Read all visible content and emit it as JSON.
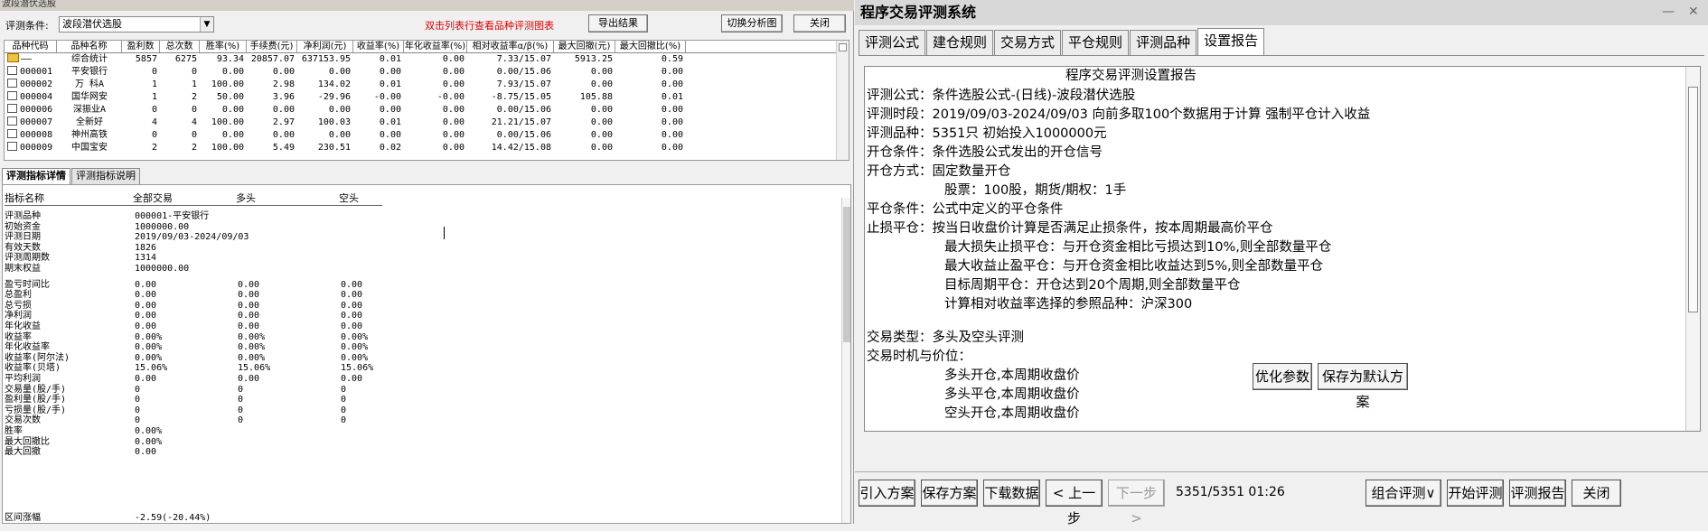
{
  "left_window": {
    "title": "波段潜伏选股",
    "condition_label": "评测条件:",
    "condition_value": "波段潜伏选股",
    "hint": "双击列表行查看品种评测图表",
    "export_label": "导出结果",
    "switch_label": "切换分析图",
    "close_label": "关闭",
    "columns": [
      "品种代码",
      "品种名称",
      "盈利数",
      "总次数",
      "胜率(%)",
      "手续费(元)",
      "净利润(元)",
      "收益率(%)",
      "年化收益率(%)",
      "相对收益率α/β(%)",
      "最大回撤(元)",
      "最大回撤比(%)"
    ],
    "rows": [
      [
        "——",
        "综合统计",
        "5857",
        "6275",
        "93.34",
        "20857.07",
        "637153.95",
        "0.01",
        "0.00",
        "7.33/15.07",
        "5913.25",
        "0.59"
      ],
      [
        "000001",
        "平安银行",
        "0",
        "0",
        "0.00",
        "0.00",
        "0.00",
        "0.00",
        "0.00",
        "0.00/15.06",
        "0.00",
        "0.00"
      ],
      [
        "000002",
        "万 科A",
        "1",
        "1",
        "100.00",
        "2.98",
        "134.02",
        "0.01",
        "0.00",
        "7.93/15.07",
        "0.00",
        "0.00"
      ],
      [
        "000004",
        "国华网安",
        "1",
        "2",
        "50.00",
        "3.96",
        "-29.96",
        "-0.00",
        "-0.00",
        "-8.75/15.05",
        "105.88",
        "0.01"
      ],
      [
        "000006",
        "深振业A",
        "0",
        "0",
        "0.00",
        "0.00",
        "0.00",
        "0.00",
        "0.00",
        "0.00/15.06",
        "0.00",
        "0.00"
      ],
      [
        "000007",
        "全新好",
        "4",
        "4",
        "100.00",
        "2.97",
        "100.03",
        "0.01",
        "0.00",
        "21.21/15.07",
        "0.00",
        "0.00"
      ],
      [
        "000008",
        "神州高铁",
        "0",
        "0",
        "0.00",
        "0.00",
        "0.00",
        "0.00",
        "0.00",
        "0.00/15.06",
        "0.00",
        "0.00"
      ],
      [
        "000009",
        "中国宝安",
        "2",
        "2",
        "100.00",
        "5.49",
        "230.51",
        "0.02",
        "0.00",
        "14.42/15.08",
        "0.00",
        "0.00"
      ]
    ],
    "tabs": [
      "评测指标详情",
      "评测指标说明"
    ],
    "detail_headers": [
      "指标名称",
      "全部交易",
      "多头",
      "空头"
    ],
    "detail_rows": [
      [
        "评测品种",
        "000001-平安银行",
        "",
        ""
      ],
      [
        "初始资金",
        "1000000.00",
        "",
        ""
      ],
      [
        "评测日期",
        "2019/09/03-2024/09/03",
        "",
        ""
      ],
      [
        "有效天数",
        "1826",
        "",
        ""
      ],
      [
        "评测周期数",
        "1314",
        "",
        ""
      ],
      [
        "期末权益",
        "1000000.00",
        "",
        ""
      ],
      [
        "盈亏时间比",
        "0.00",
        "0.00",
        "0.00"
      ],
      [
        "总盈利",
        "0.00",
        "0.00",
        "0.00"
      ],
      [
        "总亏损",
        "0.00",
        "0.00",
        "0.00"
      ],
      [
        "净利润",
        "0.00",
        "0.00",
        "0.00"
      ],
      [
        "年化收益",
        "0.00",
        "0.00",
        "0.00"
      ],
      [
        "收益率",
        "0.00%",
        "0.00%",
        "0.00%"
      ],
      [
        "年化收益率",
        "0.00%",
        "0.00%",
        "0.00%"
      ],
      [
        "收益率(阿尔法)",
        "0.00%",
        "0.00%",
        "0.00%"
      ],
      [
        "收益率(贝塔)",
        "15.06%",
        "15.06%",
        "15.06%"
      ],
      [
        "平均利润",
        "0.00",
        "0.00",
        "0.00"
      ],
      [
        "交易量(股/手)",
        "0",
        "0",
        "0"
      ],
      [
        "盈利量(股/手)",
        "0",
        "0",
        "0"
      ],
      [
        "亏损量(股/手)",
        "0",
        "0",
        "0"
      ],
      [
        "交易次数",
        "0",
        "0",
        "0"
      ],
      [
        "胜率",
        "0.00%",
        "",
        ""
      ],
      [
        "最大回撤比",
        "0.00%",
        "",
        ""
      ],
      [
        "最大回撤",
        "0.00",
        "",
        ""
      ]
    ],
    "last_row": [
      "区间涨幅",
      "-2.59(-20.44%)"
    ]
  },
  "right_window": {
    "title": "程序交易评测系统",
    "min_icon": "—",
    "close_icon": "✕",
    "tabs": [
      "评测公式",
      "建仓规则",
      "交易方式",
      "平仓规则",
      "评测品种",
      "设置报告"
    ],
    "report": {
      "heading": "程序交易评测设置报告",
      "lines": [
        "评测公式：条件选股公式-(日线)-波段潜伏选股",
        "评测时段：2019/09/03-2024/09/03 向前多取100个数据用于计算 强制平仓计入收益",
        "评测品种：5351只 初始投入1000000元",
        "开仓条件：条件选股公式发出的开仓信号",
        "开仓方式：固定数量开仓",
        "股票：100股，期货/期权：1手",
        "平仓条件：公式中定义的平仓条件",
        "止损平仓：按当日收盘价计算是否满足止损条件，按本周期最高价平仓",
        "最大损失止损平仓：与开仓资金相比亏损达到10%,则全部数量平仓",
        "最大收益止盈平仓：与开仓资金相比收益达到5%,则全部数量平仓",
        "目标周期平仓：开仓达到20个周期,则全部数量平仓",
        "计算相对收益率选择的参照品种：沪深300",
        "交易类型：多头及空头评测",
        "交易时机与价位：",
        "多头开仓,本周期收盘价",
        "多头平仓,本周期收盘价",
        "空头开仓,本周期收盘价"
      ]
    },
    "optimize_label": "优化参数",
    "save_default_label": "保存为默认方案",
    "bottom": {
      "import": "引入方案",
      "save": "保存方案",
      "download": "下载数据",
      "prev": "< 上一步",
      "next": "下一步 >",
      "status": "5351/5351 01:26",
      "combo": "组合评测∨",
      "start": "开始评测",
      "report": "评测报告",
      "close": "关闭"
    }
  }
}
